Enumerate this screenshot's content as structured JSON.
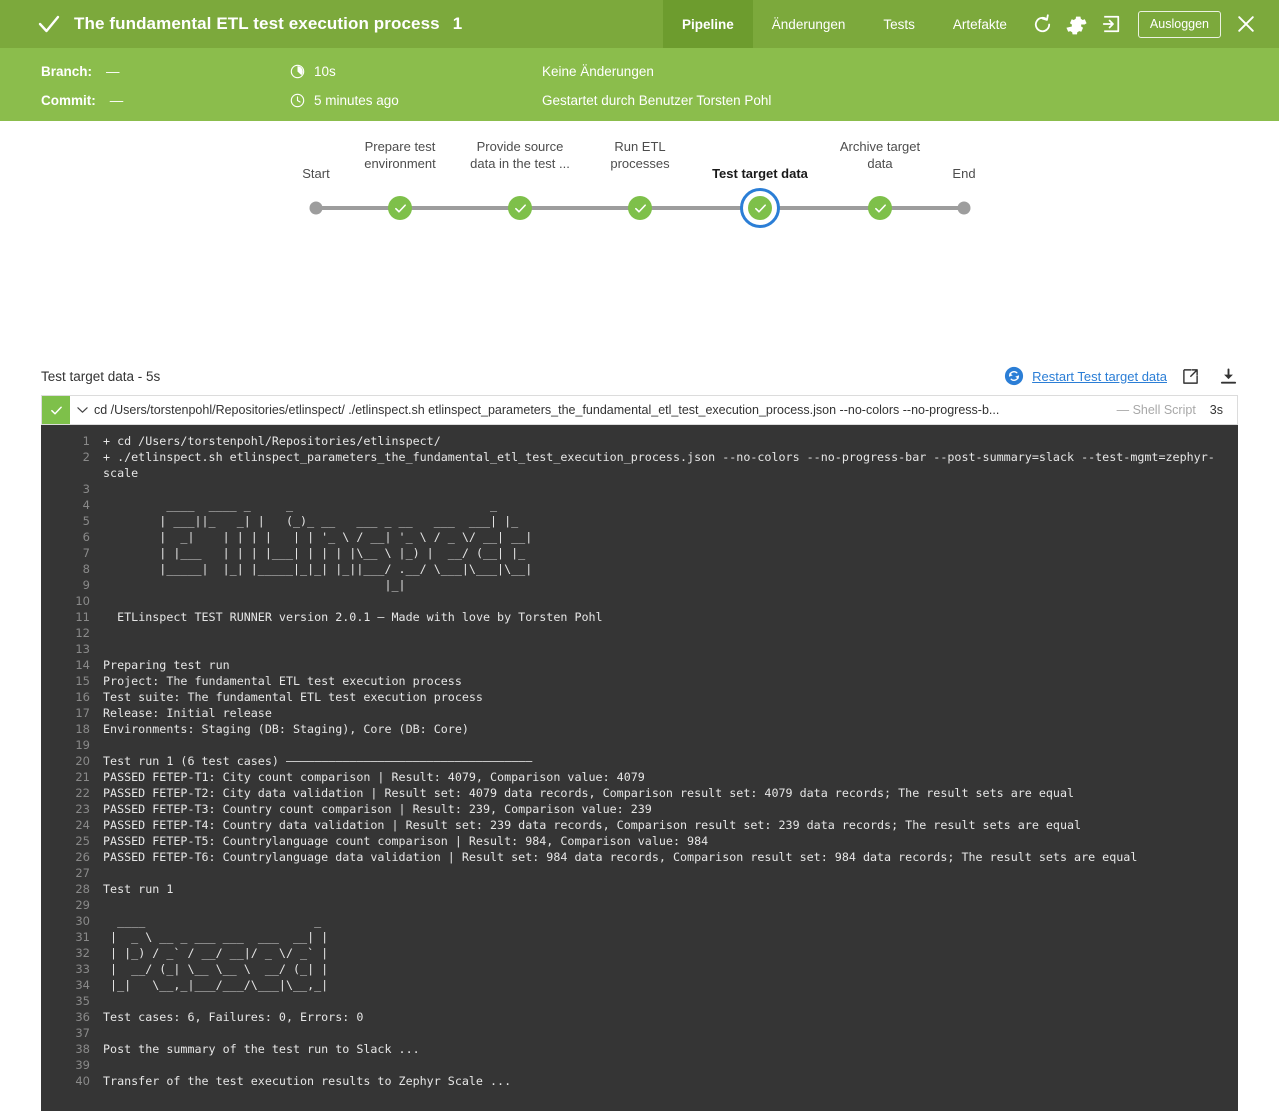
{
  "header": {
    "status_icon": "check-icon",
    "title": "The fundamental ETL test execution process",
    "build_number": "1",
    "tabs": [
      {
        "label": "Pipeline",
        "active": true
      },
      {
        "label": "Änderungen",
        "active": false
      },
      {
        "label": "Tests",
        "active": false
      },
      {
        "label": "Artefakte",
        "active": false
      }
    ],
    "icons": [
      "refresh-icon",
      "gear-icon",
      "login-arrow-icon"
    ],
    "logout_label": "Ausloggen",
    "close_icon": "close-icon"
  },
  "subheader": {
    "branch_label": "Branch:",
    "branch_value": "—",
    "commit_label": "Commit:",
    "commit_value": "—",
    "duration_icon": "stopwatch-icon",
    "duration_value": "10s",
    "time_icon": "clock-icon",
    "time_value": "5 minutes ago",
    "changes_text": "Keine Änderungen",
    "trigger_text": "Gestartet durch Benutzer Torsten Pohl"
  },
  "pipeline": {
    "stages": [
      {
        "label": "Start",
        "type": "endpoint",
        "state": "dot"
      },
      {
        "label": "Prepare test\nenvironment",
        "type": "stage",
        "state": "success"
      },
      {
        "label": "Provide source\ndata in the test ...",
        "type": "stage",
        "state": "success"
      },
      {
        "label": "Run ETL\nprocesses",
        "type": "stage",
        "state": "success"
      },
      {
        "label": "Test target data",
        "type": "stage",
        "state": "success-selected"
      },
      {
        "label": "Archive target\ndata",
        "type": "stage",
        "state": "success"
      },
      {
        "label": "End",
        "type": "endpoint",
        "state": "dot"
      }
    ]
  },
  "log_section": {
    "title": "Test target data - 5s",
    "restart_icon": "restart-circle-icon",
    "restart_label": "Restart Test target data",
    "popout_icon": "external-link-icon",
    "download_icon": "download-icon",
    "accent_color": "#2b7ed6"
  },
  "command_bar": {
    "status_icon": "check-icon",
    "chevron_icon": "chevron-down-icon",
    "command": "cd /Users/torstenpohl/Repositories/etlinspect/ ./etlinspect.sh etlinspect_parameters_the_fundamental_etl_test_execution_process.json --no-colors --no-progress-b...",
    "type_label": "— Shell Script",
    "duration": "3s"
  },
  "terminal": {
    "background_color": "#353535",
    "lines": [
      {
        "n": "1",
        "t": "+ cd /Users/torstenpohl/Repositories/etlinspect/"
      },
      {
        "n": "2",
        "t": "+ ./etlinspect.sh etlinspect_parameters_the_fundamental_etl_test_execution_process.json --no-colors --no-progress-bar --post-summary=slack --test-mgmt=zephyr-scale"
      },
      {
        "n": "3",
        "t": ""
      },
      {
        "n": "4",
        "t": "         ____  ____ _     _                            _"
      },
      {
        "n": "5",
        "t": "        | ___||_   _| |   (_)_ __   ___ _ __   ___  ___| |_"
      },
      {
        "n": "6",
        "t": "        |  _|    | | | |   | | '_ \\ / __| '_ \\ / _ \\/ __| __|"
      },
      {
        "n": "7",
        "t": "        | |___   | | | |___| | | | |\\__ \\ |_) |  __/ (__| |_"
      },
      {
        "n": "8",
        "t": "        |_____|  |_| |_____|_|_| |_||___/ .__/ \\___|\\___|\\__|"
      },
      {
        "n": "9",
        "t": "                                        |_|"
      },
      {
        "n": "10",
        "t": ""
      },
      {
        "n": "11",
        "t": "  ETLinspect TEST RUNNER version 2.0.1 — Made with love by Torsten Pohl"
      },
      {
        "n": "12",
        "t": ""
      },
      {
        "n": "13",
        "t": ""
      },
      {
        "n": "14",
        "t": "Preparing test run"
      },
      {
        "n": "15",
        "t": "Project: The fundamental ETL test execution process"
      },
      {
        "n": "16",
        "t": "Test suite: The fundamental ETL test execution process"
      },
      {
        "n": "17",
        "t": "Release: Initial release"
      },
      {
        "n": "18",
        "t": "Environments: Staging (DB: Staging), Core (DB: Core)"
      },
      {
        "n": "19",
        "t": ""
      },
      {
        "n": "20",
        "t": "Test run 1 (6 test cases) ———————————————————————————————————"
      },
      {
        "n": "21",
        "t": "PASSED FETEP-T1: City count comparison | Result: 4079, Comparison value: 4079"
      },
      {
        "n": "22",
        "t": "PASSED FETEP-T2: City data validation | Result set: 4079 data records, Comparison result set: 4079 data records; The result sets are equal"
      },
      {
        "n": "23",
        "t": "PASSED FETEP-T3: Country count comparison | Result: 239, Comparison value: 239"
      },
      {
        "n": "24",
        "t": "PASSED FETEP-T4: Country data validation | Result set: 239 data records, Comparison result set: 239 data records; The result sets are equal"
      },
      {
        "n": "25",
        "t": "PASSED FETEP-T5: Countrylanguage count comparison | Result: 984, Comparison value: 984"
      },
      {
        "n": "26",
        "t": "PASSED FETEP-T6: Countrylanguage data validation | Result set: 984 data records, Comparison result set: 984 data records; The result sets are equal"
      },
      {
        "n": "27",
        "t": ""
      },
      {
        "n": "28",
        "t": "Test run 1"
      },
      {
        "n": "29",
        "t": ""
      },
      {
        "n": "30",
        "t": "  ____                        _"
      },
      {
        "n": "31",
        "t": " |  _ \\ __ _ ___ ___  ___  __| |"
      },
      {
        "n": "32",
        "t": " | |_) / _` / __/ __|/ _ \\/ _` |"
      },
      {
        "n": "33",
        "t": " |  __/ (_| \\__ \\__ \\  __/ (_| |"
      },
      {
        "n": "34",
        "t": " |_|   \\__,_|___/___/\\___|\\__,_|"
      },
      {
        "n": "35",
        "t": ""
      },
      {
        "n": "36",
        "t": "Test cases: 6, Failures: 0, Errors: 0"
      },
      {
        "n": "37",
        "t": ""
      },
      {
        "n": "38",
        "t": "Post the summary of the test run to Slack ..."
      },
      {
        "n": "39",
        "t": ""
      },
      {
        "n": "40",
        "t": "Transfer of the test execution results to Zephyr Scale ..."
      }
    ]
  }
}
